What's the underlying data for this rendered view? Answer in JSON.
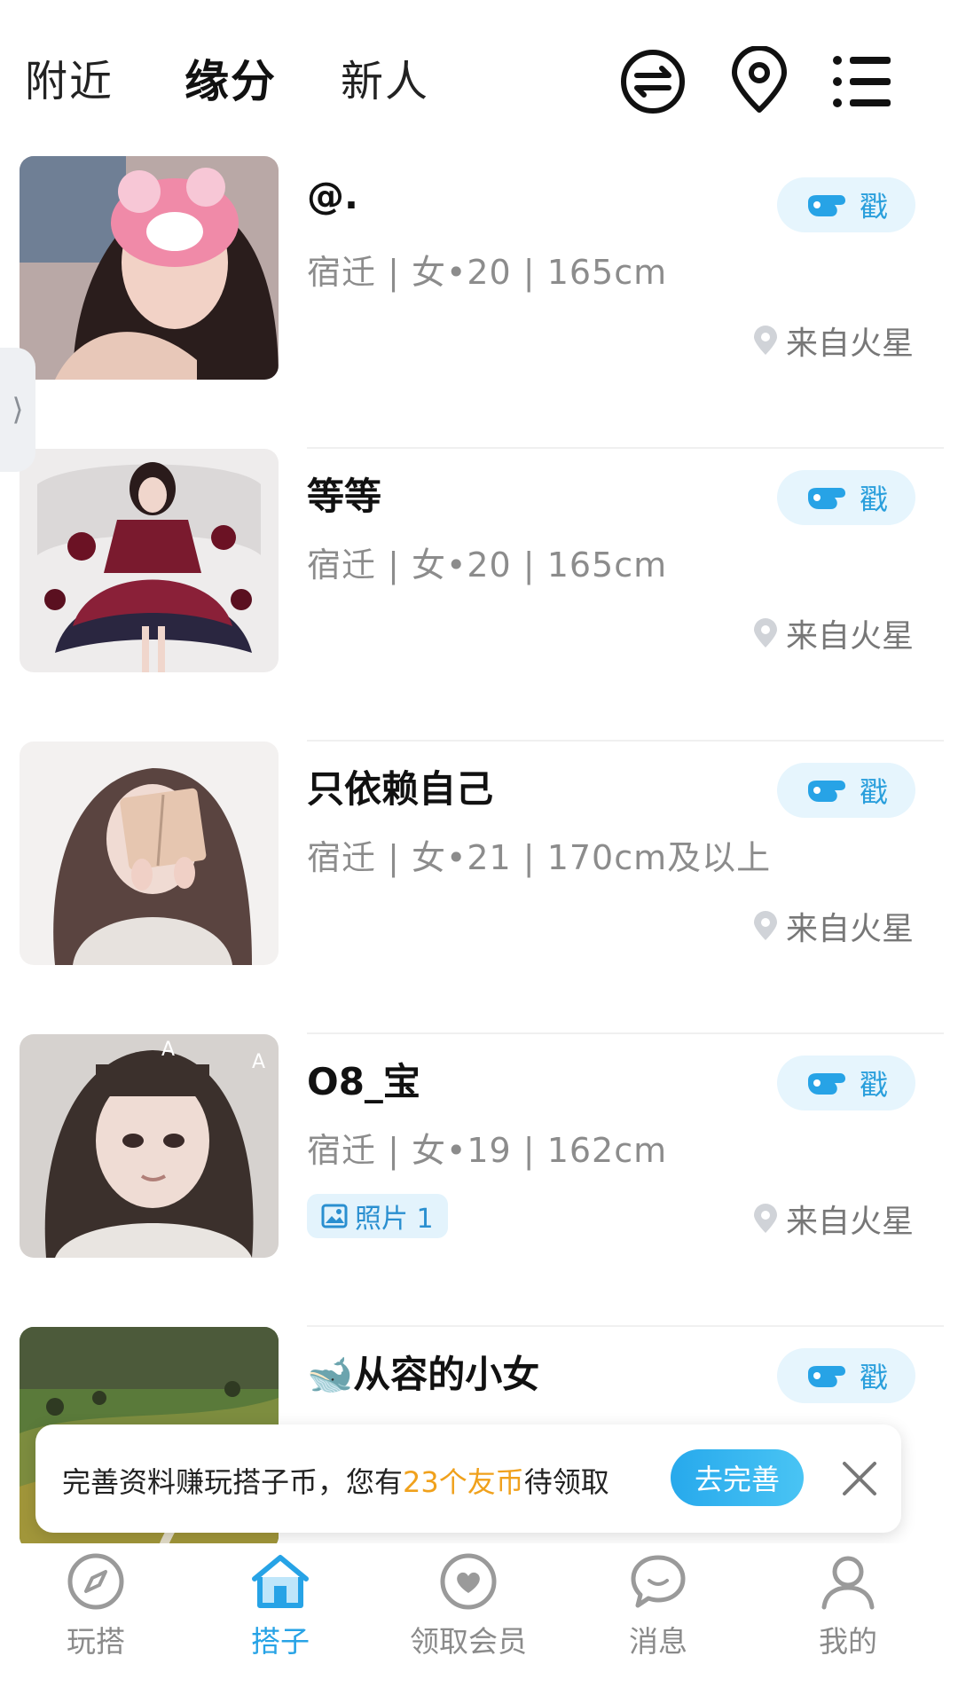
{
  "header": {
    "tabs": [
      {
        "label": "附近",
        "active": false
      },
      {
        "label": "缘分",
        "active": true
      },
      {
        "label": "新人",
        "active": false
      }
    ],
    "icons": [
      "swap-icon",
      "location-pin-icon",
      "menu-list-icon"
    ]
  },
  "side_handle": {
    "glyph": "⟩"
  },
  "users": [
    {
      "name": "@.",
      "info": "宿迁 | 女•20 | 165cm",
      "location": "来自火星",
      "poke_label": "戳",
      "photo": ""
    },
    {
      "name": "等等",
      "info": "宿迁 | 女•20 | 165cm",
      "location": "来自火星",
      "poke_label": "戳",
      "photo": ""
    },
    {
      "name": "只依赖自己",
      "info": "宿迁 | 女•21 | 170cm及以上",
      "location": "来自火星",
      "poke_label": "戳",
      "photo": ""
    },
    {
      "name": "O8_宝",
      "info": "宿迁 | 女•19 | 162cm",
      "location": "来自火星",
      "poke_label": "戳",
      "photo": "照片 1"
    },
    {
      "name": "🐋从容的小女",
      "info": "",
      "location": "",
      "poke_label": "戳",
      "photo": ""
    }
  ],
  "toast": {
    "text_before": "完善资料赚玩搭子币，您有",
    "highlight": "23个友币",
    "text_after": "待领取",
    "button": "去完善",
    "highlight_color": "#f0a11c"
  },
  "bottom_nav": [
    {
      "label": "玩搭",
      "icon": "compass-icon",
      "active": false
    },
    {
      "label": "搭子",
      "icon": "home-icon",
      "active": true
    },
    {
      "label": "领取会员",
      "icon": "heart-badge-icon",
      "active": false
    },
    {
      "label": "消息",
      "icon": "chat-bubble-icon",
      "active": false
    },
    {
      "label": "我的",
      "icon": "profile-icon",
      "active": false
    }
  ],
  "colors": {
    "accent": "#27a3e6",
    "poke_bg": "#e6f5fd",
    "secondary_text": "#8c8c8c"
  }
}
